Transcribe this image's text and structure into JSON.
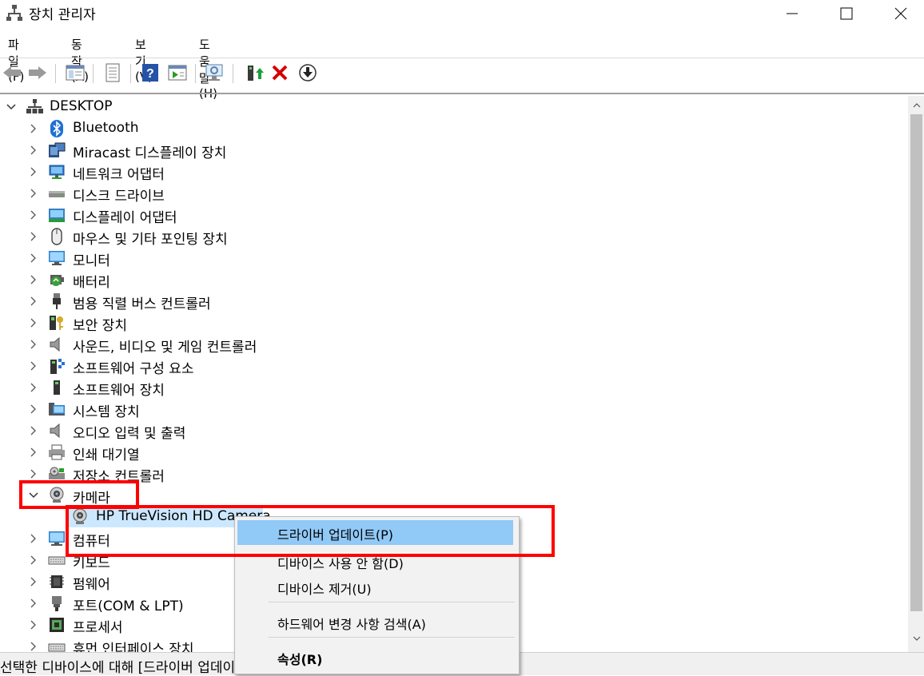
{
  "window": {
    "title": "장치 관리자"
  },
  "menu": [
    "파일(F)",
    "동작(A)",
    "보기(V)",
    "도움말(H)"
  ],
  "toolbar": {
    "icons": [
      "back-arrow-icon",
      "forward-arrow-icon",
      "show-hide-tree-icon",
      "properties-icon",
      "help-icon",
      "run-icon",
      "scan-monitor-icon",
      "update-driver-icon",
      "uninstall-x-icon",
      "disable-down-icon"
    ]
  },
  "tree": {
    "root": "DESKTOP",
    "items": [
      {
        "label": "Bluetooth",
        "icon": "bluetooth-icon"
      },
      {
        "label": "Miracast 디스플레이 장치",
        "icon": "miracast-icon"
      },
      {
        "label": "네트워크 어댑터",
        "icon": "network-adapter-icon"
      },
      {
        "label": "디스크 드라이브",
        "icon": "disk-drive-icon"
      },
      {
        "label": "디스플레이 어댑터",
        "icon": "display-adapter-icon"
      },
      {
        "label": "마우스 및 기타 포인팅 장치",
        "icon": "mouse-icon"
      },
      {
        "label": "모니터",
        "icon": "monitor-icon"
      },
      {
        "label": "배터리",
        "icon": "battery-icon"
      },
      {
        "label": "범용 직렬 버스 컨트롤러",
        "icon": "usb-icon"
      },
      {
        "label": "보안 장치",
        "icon": "security-device-icon"
      },
      {
        "label": "사운드, 비디오 및 게임 컨트롤러",
        "icon": "speaker-icon"
      },
      {
        "label": "소프트웨어 구성 요소",
        "icon": "software-component-icon"
      },
      {
        "label": "소프트웨어 장치",
        "icon": "software-device-icon"
      },
      {
        "label": "시스템 장치",
        "icon": "system-device-icon"
      },
      {
        "label": "오디오 입력 및 출력",
        "icon": "audio-icon"
      },
      {
        "label": "인쇄 대기열",
        "icon": "printer-icon"
      },
      {
        "label": "저장소 컨트롤러",
        "icon": "storage-controller-icon"
      },
      {
        "label": "카메라",
        "icon": "camera-icon"
      }
    ],
    "camera_child": "HP TrueVision HD Camera",
    "items_after": [
      {
        "label": "컴퓨터",
        "icon": "computer-icon"
      },
      {
        "label": "키보드",
        "icon": "keyboard-icon"
      },
      {
        "label": "펌웨어",
        "icon": "firmware-icon"
      },
      {
        "label": "포트(COM & LPT)",
        "icon": "port-icon"
      },
      {
        "label": "프로세서",
        "icon": "processor-icon"
      },
      {
        "label": "휴먼 인터페이스 장치",
        "icon": "hid-icon"
      }
    ]
  },
  "context_menu": {
    "items": [
      "드라이버 업데이트(P)",
      "디바이스 사용 안 함(D)",
      "디바이스 제거(U)",
      "하드웨어 변경 사항 검색(A)",
      "속성(R)"
    ]
  },
  "status": "선택한 디바이스에 대해 [드라이버 업데이트 마법사]를 시작합니다.",
  "colors": {
    "highlight_box": "#ff0000",
    "menu_hover": "#91c9f7",
    "selected_row": "#cce8ff"
  }
}
